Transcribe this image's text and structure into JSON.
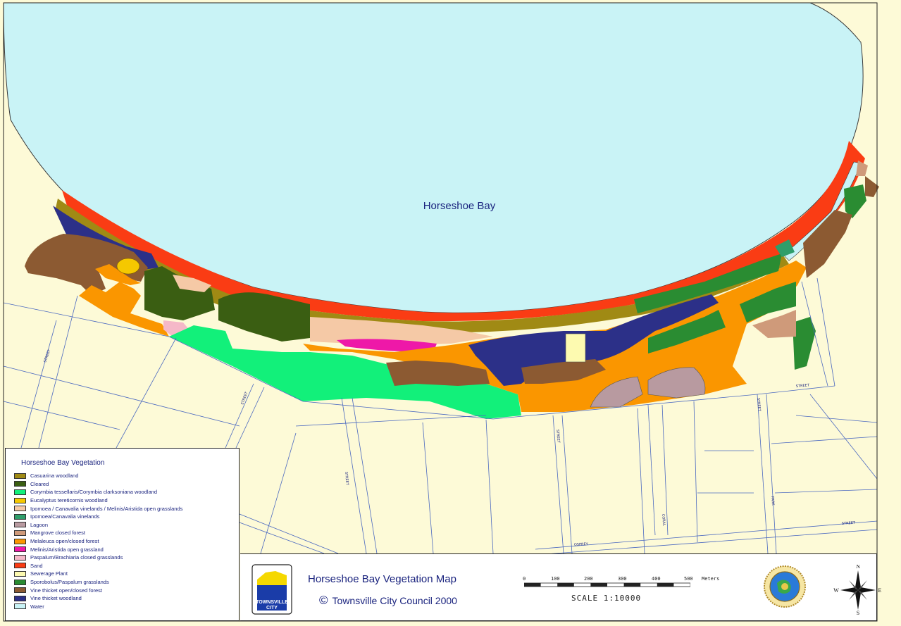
{
  "map": {
    "bay_label": "Horseshoe Bay",
    "colors": {
      "land": "#fdfad7",
      "water": "#c9f3f6",
      "road_line": "#4a68c0",
      "coast_line": "#3a3a3a"
    }
  },
  "legend": {
    "title": "Horseshoe Bay Vegetation",
    "items": [
      {
        "label": "Casuarina woodland",
        "color": "#a08a14"
      },
      {
        "label": "Cleared",
        "color": "#3a5e12"
      },
      {
        "label": "Corymbia tessellaris/Corymbia clarksoniana woodland",
        "color": "#12f07a"
      },
      {
        "label": "Eucalyptus tereticornis woodland",
        "color": "#f5c800"
      },
      {
        "label": "Ipomoea / Canavalia vinelands / Melinis/Aristida open grasslands",
        "color": "#f5c9a6"
      },
      {
        "label": "Ipomoea/Canavalia vinelands",
        "color": "#2f9e6a"
      },
      {
        "label": "Lagoon",
        "color": "#b89aa0"
      },
      {
        "label": "Mangrove closed forest",
        "color": "#cf9a7a"
      },
      {
        "label": "Melaleuca open/closed forest",
        "color": "#fa9600"
      },
      {
        "label": "Melinis/Aristida open grassland",
        "color": "#ee18a8"
      },
      {
        "label": "Paspalum/Brachiaria closed grasslands",
        "color": "#f5b8c8"
      },
      {
        "label": "Sand",
        "color": "#fa3c14"
      },
      {
        "label": "Sewerage Plant",
        "color": "#fdfab0"
      },
      {
        "label": "Sporobolus/Paspalum grasslands",
        "color": "#2a8c32"
      },
      {
        "label": "Vine thicket open/closed forest",
        "color": "#8c5a32"
      },
      {
        "label": "Vine thicket woodland",
        "color": "#2c3088"
      },
      {
        "label": "Water",
        "color": "#c9f3f6"
      }
    ]
  },
  "title_block": {
    "map_title": "Horseshoe Bay Vegetation Map",
    "copyright_symbol": "©",
    "copyright": "Townsville City Council 2000",
    "logo_text_top": "TOWNSVILLE",
    "logo_text_bottom": "CITY",
    "scale_ticks": [
      "0",
      "100",
      "200",
      "300",
      "400",
      "500"
    ],
    "scale_units": "Meters",
    "scale_text": "SCALE  1:10000",
    "compass": {
      "n": "N",
      "s": "S",
      "e": "E",
      "w": "W"
    }
  },
  "streets": [
    "STREET",
    "STREET",
    "STREET",
    "STREET",
    "STREET",
    "STREET",
    "STREET",
    "CORAL",
    "OSPREY",
    "PARK"
  ]
}
